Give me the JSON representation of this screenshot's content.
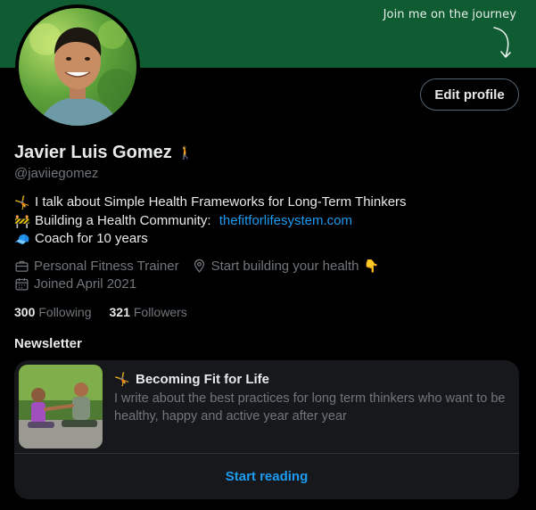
{
  "banner": {
    "text": "Join me on the journey"
  },
  "profile": {
    "name": "Javier Luis Gomez",
    "name_emoji": "🚶",
    "handle": "@javiiegomez",
    "edit_label": "Edit profile",
    "bio": [
      {
        "emoji": "🤸",
        "text": "I talk about Simple Health Frameworks for Long-Term Thinkers"
      },
      {
        "emoji": "🚧",
        "text": "Building a Health Community: ",
        "link": "thefitforlifesystem.com"
      },
      {
        "emoji": "🧢",
        "text": "Coach for 10 years"
      }
    ],
    "category": "Personal Fitness Trainer",
    "location": "Start building your health",
    "location_emoji": "👇",
    "joined": "Joined April 2021",
    "following_count": "300",
    "following_label": "Following",
    "followers_count": "321",
    "followers_label": "Followers"
  },
  "newsletter": {
    "section_title": "Newsletter",
    "emoji": "🤸",
    "title": "Becoming Fit for Life",
    "description": "I write about the best practices for long term thinkers who want to be healthy, happy and active year after year",
    "cta": "Start reading"
  },
  "colors": {
    "banner": "#0f5b32",
    "link": "#1d9bf0",
    "muted": "#71767b",
    "card": "#16181c"
  },
  "icons": [
    "arrow-curve-icon",
    "briefcase-icon",
    "location-pin-icon",
    "calendar-icon"
  ]
}
